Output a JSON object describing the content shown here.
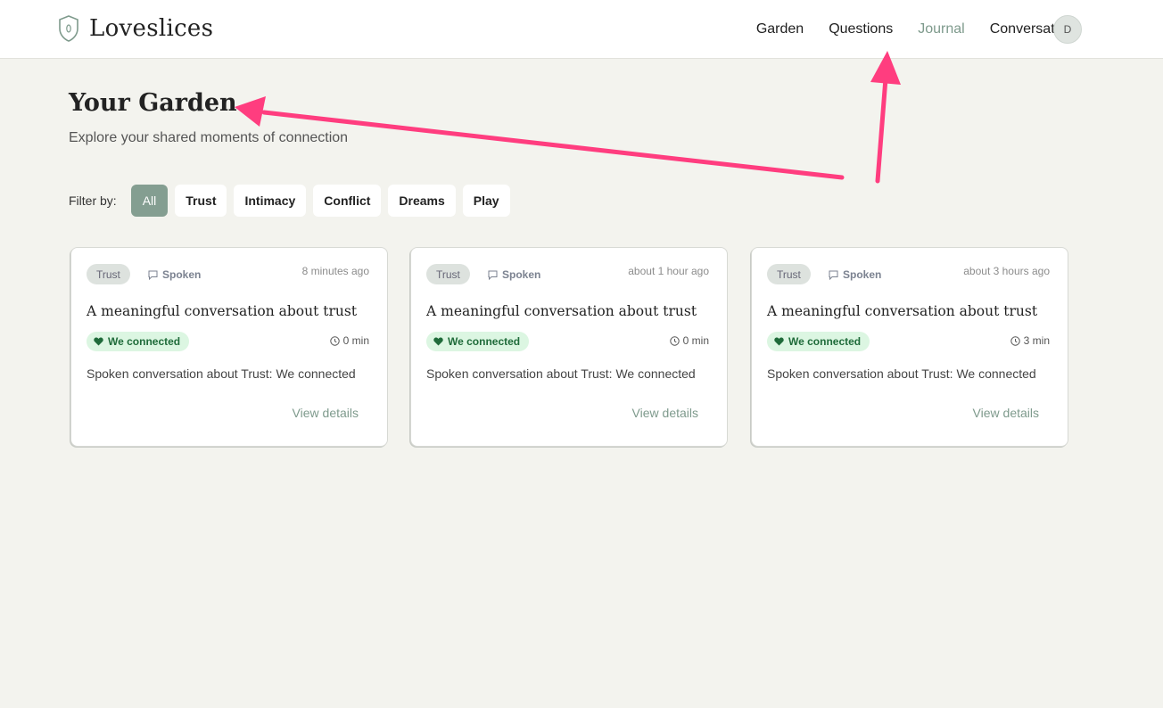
{
  "header": {
    "brand": "Loveslices",
    "nav": [
      "Garden",
      "Questions",
      "Journal",
      "Conversations"
    ],
    "active_nav": "Journal",
    "avatar_initial": "D"
  },
  "page": {
    "title": "Your Garden",
    "subtitle": "Explore your shared moments of connection"
  },
  "filters": {
    "label": "Filter by:",
    "options": [
      "All",
      "Trust",
      "Intimacy",
      "Conflict",
      "Dreams",
      "Play"
    ],
    "active": "All"
  },
  "cards": [
    {
      "tag": "Trust",
      "type": "Spoken",
      "time": "8 minutes ago",
      "title": "A meaningful conversation about trust",
      "badge": "We connected",
      "duration": "0 min",
      "summary": "Spoken conversation about Trust: We connected",
      "link": "View details"
    },
    {
      "tag": "Trust",
      "type": "Spoken",
      "time": "about 1 hour ago",
      "title": "A meaningful conversation about trust",
      "badge": "We connected",
      "duration": "0 min",
      "summary": "Spoken conversation about Trust: We connected",
      "link": "View details"
    },
    {
      "tag": "Trust",
      "type": "Spoken",
      "time": "about 3 hours ago",
      "title": "A meaningful conversation about trust",
      "badge": "We connected",
      "duration": "3 min",
      "summary": "Spoken conversation about Trust: We connected",
      "link": "View details"
    }
  ],
  "colors": {
    "accent": "#849e91",
    "annotation_arrow": "#ff3d7f",
    "badge_bg": "#dcf6e2",
    "page_bg": "#f3f3ee"
  },
  "icons": {
    "brand": "shield-icon",
    "type": "chat-bubble-icon",
    "badge": "heart-icon",
    "duration": "clock-icon"
  }
}
